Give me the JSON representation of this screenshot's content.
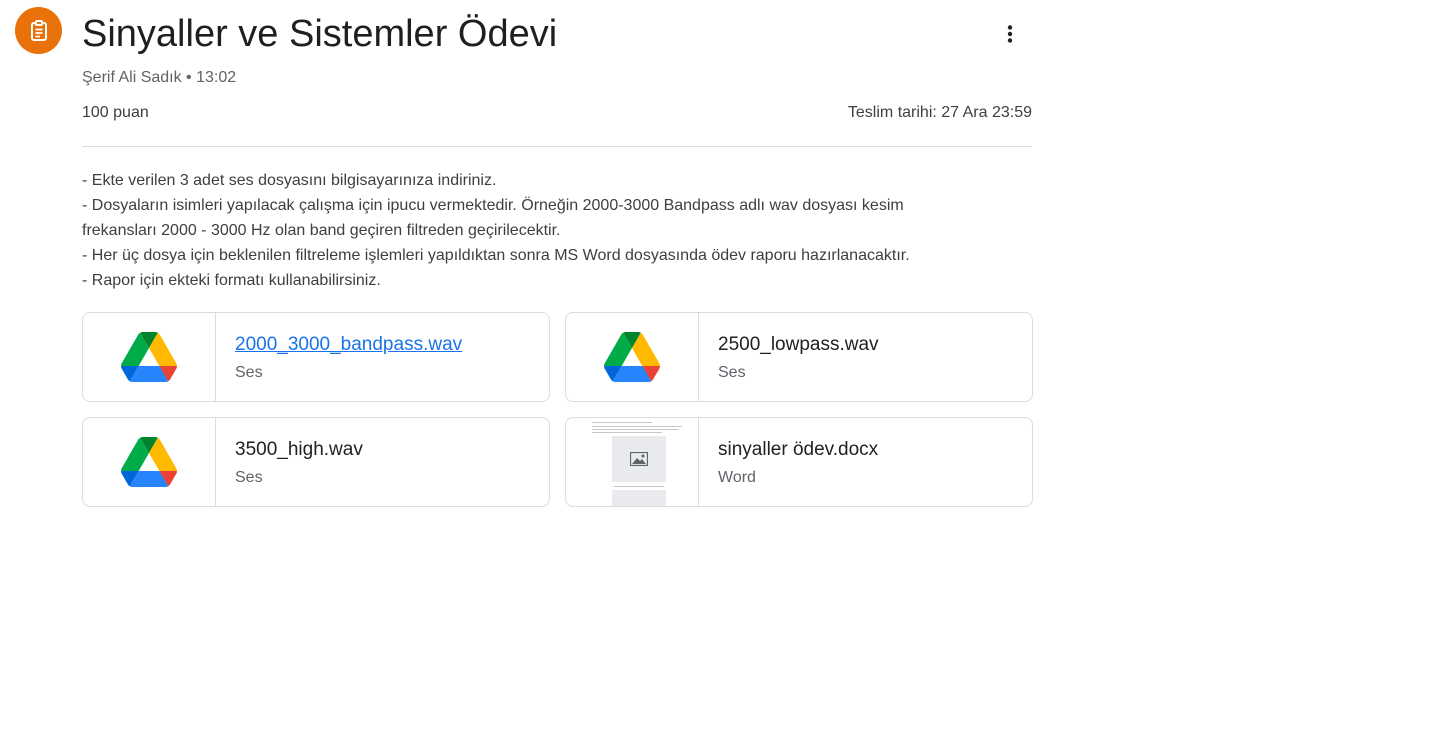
{
  "assignment": {
    "title": "Sinyaller ve Sistemler Ödevi",
    "author_time": "Şerif Ali Sadık • 13:02",
    "points": "100 puan",
    "due": "Teslim tarihi: 27 Ara 23:59",
    "icon": "assignment-icon",
    "accent_color": "#e8710a"
  },
  "description": [
    "- Ekte verilen 3 adet ses dosyasını bilgisayarınıza indiriniz.",
    "- Dosyaların isimleri yapılacak çalışma için ipucu vermektedir. Örneğin 2000-3000 Bandpass adlı wav dosyası kesim",
    "frekansları 2000 - 3000 Hz olan band geçiren filtreden geçirilecektir.",
    "- Her üç dosya için beklenilen filtreleme işlemleri yapıldıktan sonra MS Word dosyasında ödev raporu hazırlanacaktır.",
    "- Rapor için ekteki formatı kullanabilirsiniz."
  ],
  "attachments": [
    {
      "name": "2000_3000_bandpass.wav",
      "type": "Ses",
      "icon": "google-drive-icon"
    },
    {
      "name": "2500_lowpass.wav",
      "type": "Ses",
      "icon": "google-drive-icon"
    },
    {
      "name": "3500_high.wav",
      "type": "Ses",
      "icon": "google-drive-icon"
    },
    {
      "name": "sinyaller ödev.docx",
      "type": "Word",
      "icon": "document-thumbnail"
    }
  ],
  "menu": {
    "icon": "more-vert-icon"
  },
  "link_color": "#1a73e8"
}
